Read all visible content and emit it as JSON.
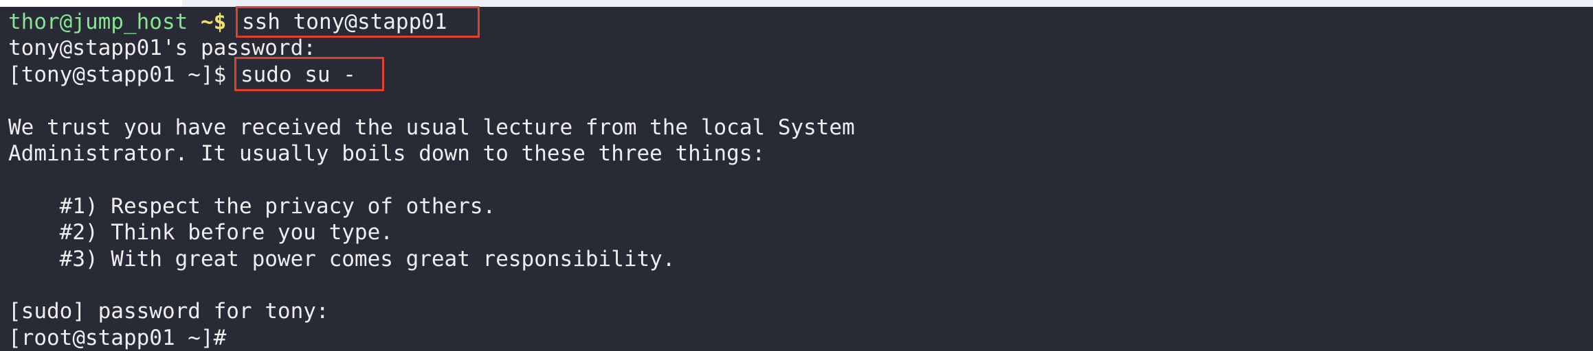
{
  "terminal": {
    "lines": {
      "l1_user": "thor@jump_host",
      "l1_prompt": " ~$",
      "l1_cmd": "ssh tony@stapp01",
      "l2": "tony@stapp01's password:",
      "l3_prompt": "[tony@stapp01 ~]$ ",
      "l3_cmd": "sudo su -",
      "l5": "We trust you have received the usual lecture from the local System",
      "l6": "Administrator. It usually boils down to these three things:",
      "l8": "    #1) Respect the privacy of others.",
      "l9": "    #2) Think before you type.",
      "l10": "    #3) With great power comes great responsibility.",
      "l12": "[sudo] password for tony:",
      "l13": "[root@stapp01 ~]#"
    },
    "colors": {
      "background": "#282a36",
      "user": "#86e58e",
      "prompt": "#f1e26a",
      "highlight": "#e0402c"
    }
  }
}
